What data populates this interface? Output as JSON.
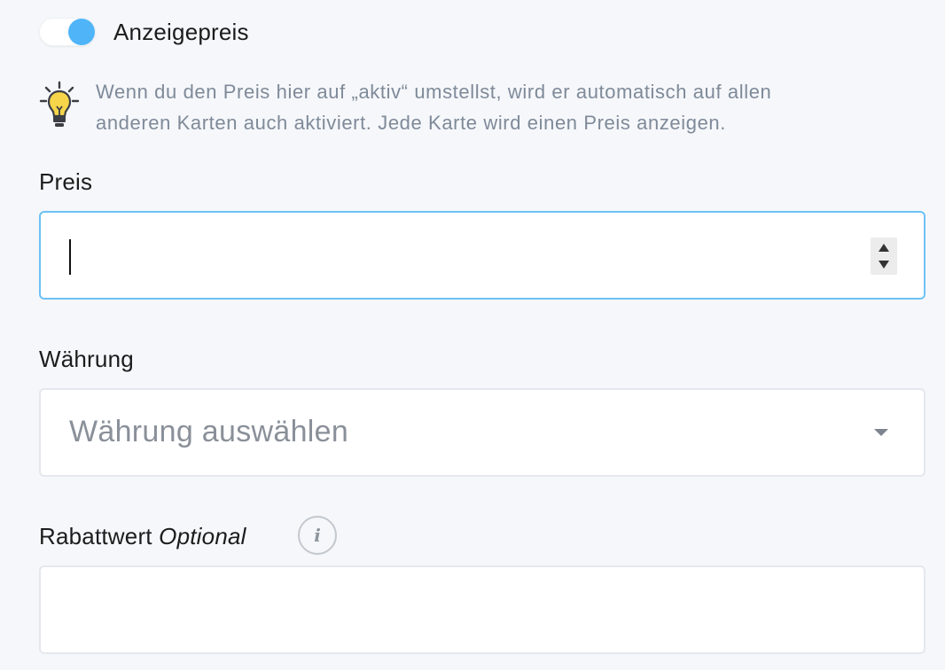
{
  "toggle": {
    "label": "Anzeigepreis",
    "state": "on",
    "accent_color": "#4fb4f8"
  },
  "hint": {
    "icon": "lightbulb-icon",
    "line1": "Wenn du den Preis hier auf „aktiv“ umstellst, wird er automatisch auf allen",
    "line2": "anderen Karten auch aktiviert. Jede Karte wird einen Preis anzeigen."
  },
  "price": {
    "label": "Preis",
    "value": "",
    "focus_color": "#6ec1f5"
  },
  "currency": {
    "label": "Währung",
    "placeholder": "Währung auswählen"
  },
  "discount": {
    "label": "Rabattwert",
    "optional_label": "Optional",
    "info_icon": "i",
    "value": ""
  }
}
